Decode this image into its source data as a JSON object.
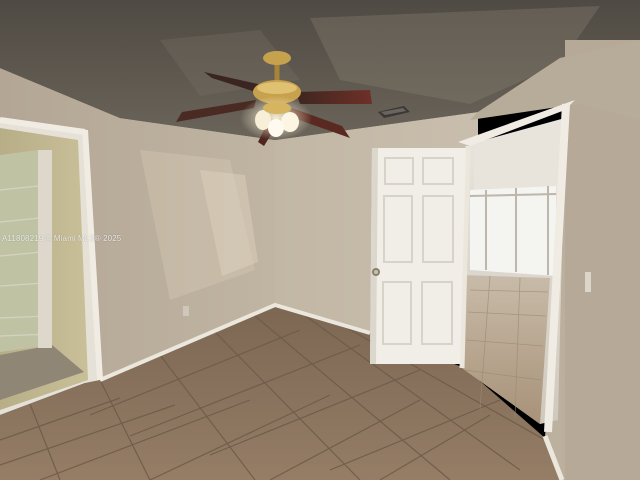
{
  "photo": {
    "kind": "interior-photo",
    "subject": "empty bedroom",
    "watermark": "A11808219 © Miami MLS® 2025"
  },
  "palette": {
    "ceiling": "#5e5850",
    "wall_left": "#b7aa98",
    "wall_back": "#c5baa8",
    "wall_right": "#b8ab9a",
    "floor": "#8a735d",
    "grout": "#6e5c4b",
    "trim": "#ece7dd",
    "door": "#f1eee8",
    "fan_brass": "#c7a24e",
    "fan_blade": "#5a2a22",
    "hall_glass": "#f3f3ef"
  },
  "objects": [
    {
      "name": "ceiling-fan",
      "icon": "ceiling-fan-with-light"
    },
    {
      "name": "air-vent",
      "icon": "ceiling-vent"
    },
    {
      "name": "interior-door",
      "icon": "six-panel-door",
      "state": "open"
    },
    {
      "name": "closet-opening",
      "icon": "wire-shelving"
    },
    {
      "name": "hallway",
      "icon": "glass-sliding-door"
    }
  ]
}
